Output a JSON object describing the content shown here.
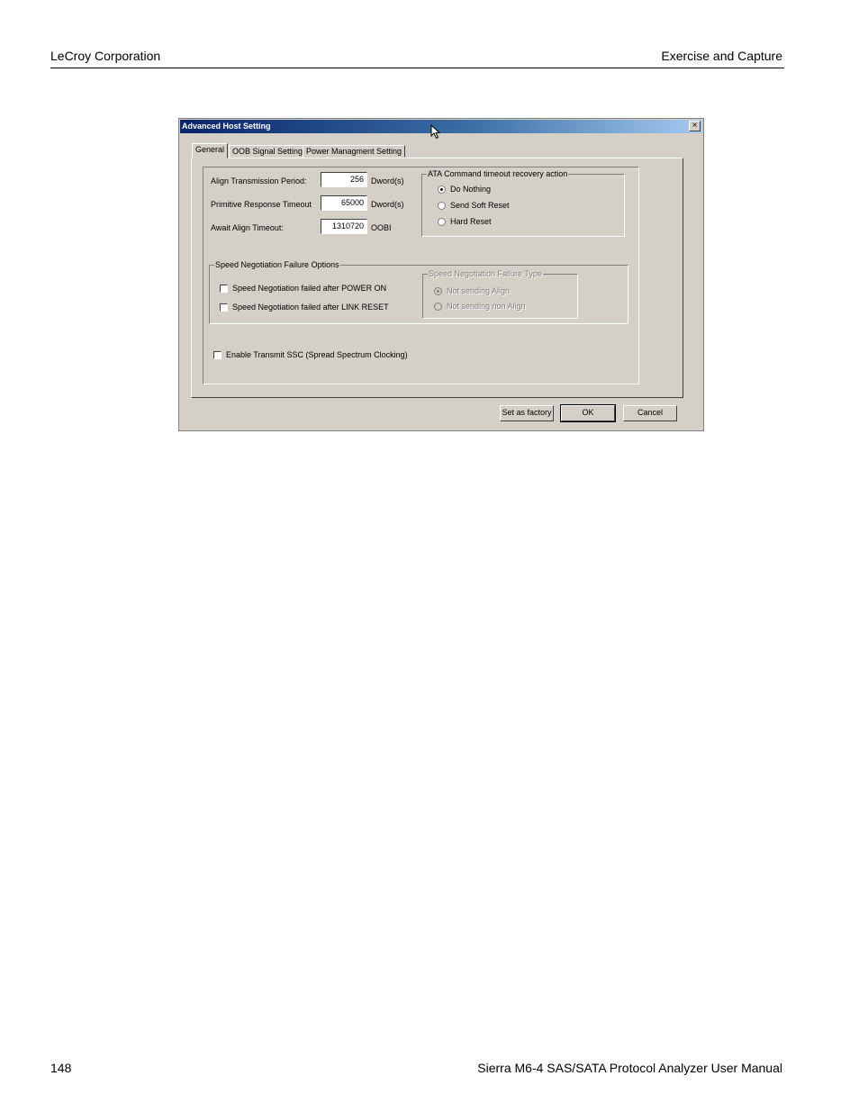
{
  "page": {
    "header_left": "LeCroy Corporation",
    "header_right": "Exercise and Capture",
    "footer_page": "148",
    "footer_title": "Sierra M6-4 SAS/SATA Protocol Analyzer User Manual"
  },
  "dialog": {
    "title": "Advanced Host Setting",
    "close_glyph": "×",
    "tabs": [
      {
        "label": "General"
      },
      {
        "label": "OOB Signal Setting"
      },
      {
        "label": "Power Managment Setting"
      }
    ],
    "fields": [
      {
        "label": "Align Transmission Period:",
        "value": "256",
        "unit": "Dword(s)"
      },
      {
        "label": "Primitive Response Timeout",
        "value": "65000",
        "unit": "Dword(s)"
      },
      {
        "label": "Await Align Timeout:",
        "value": "1310720",
        "unit": "OOBI"
      }
    ],
    "ata_group": {
      "title": "ATA Command timeout recovery action",
      "options": [
        {
          "label": "Do Nothing",
          "selected": true
        },
        {
          "label": "Send Soft Reset",
          "selected": false
        },
        {
          "label": "Hard Reset",
          "selected": false
        }
      ]
    },
    "speed_group": {
      "title": "Speed Negotiation Failure Options",
      "checks": [
        {
          "label": "Speed Negotiation failed after POWER ON",
          "checked": false
        },
        {
          "label": "Speed Negotiation failed after LINK RESET",
          "checked": false
        }
      ],
      "type_group": {
        "title": "Speed Negotiation Failure Type",
        "options": [
          {
            "label": "Not sending Align",
            "selected": true
          },
          {
            "label": "Not sending non Align",
            "selected": false
          }
        ]
      }
    },
    "ssc_check": {
      "label": "Enable Transmit SSC (Spread Spectrum Clocking)",
      "checked": false
    },
    "buttons": {
      "factory": "Set as factory",
      "ok": "OK",
      "cancel": "Cancel"
    }
  }
}
